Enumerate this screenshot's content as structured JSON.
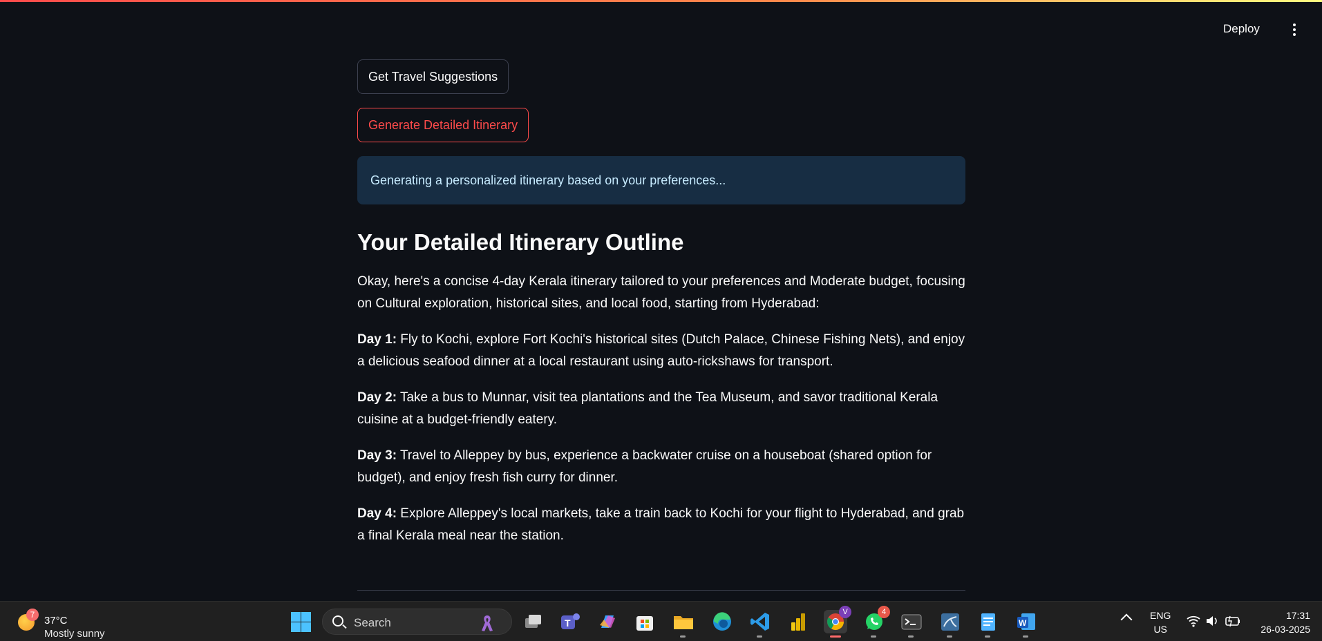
{
  "header": {
    "deploy_label": "Deploy"
  },
  "main": {
    "suggestions_button": "Get Travel Suggestions",
    "itinerary_button": "Generate Detailed Itinerary",
    "info_message": "Generating a personalized itinerary based on your preferences...",
    "heading": "Your Detailed Itinerary Outline",
    "intro": "Okay, here's a concise 4-day Kerala itinerary tailored to your preferences and Moderate budget, focusing on Cultural exploration, historical sites, and local food, starting from Hyderabad:",
    "days": [
      {
        "label": "Day 1:",
        "text": " Fly to Kochi, explore Fort Kochi's historical sites (Dutch Palace, Chinese Fishing Nets), and enjoy a delicious seafood dinner at a local restaurant using auto-rickshaws for transport."
      },
      {
        "label": "Day 2:",
        "text": " Take a bus to Munnar, visit tea plantations and the Tea Museum, and savor traditional Kerala cuisine at a budget-friendly eatery."
      },
      {
        "label": "Day 3:",
        "text": " Travel to Alleppey by bus, experience a backwater cruise on a houseboat (shared option for budget), and enjoy fresh fish curry for dinner."
      },
      {
        "label": "Day 4:",
        "text": " Explore Alleppey's local markets, take a train back to Kochi for your flight to Hyderabad, and grab a final Kerala meal near the station."
      }
    ]
  },
  "taskbar": {
    "weather": {
      "badge": "7",
      "temp": "37°C",
      "desc": "Mostly sunny"
    },
    "search_label": "Search",
    "chrome_badge": "V",
    "whatsapp_badge": "4",
    "lang_line1": "ENG",
    "lang_line2": "US",
    "time": "17:31",
    "date": "26-03-2025"
  },
  "colors": {
    "background": "#0e1117",
    "accent_red": "#ff4b4b",
    "info_bg": "#172d43",
    "info_text": "#c7ebff"
  }
}
